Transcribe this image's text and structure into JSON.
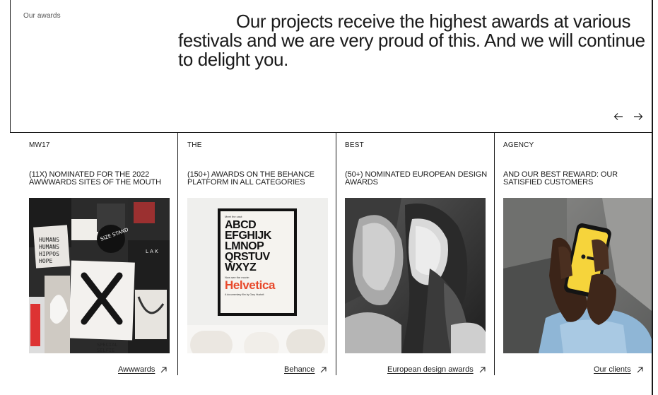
{
  "section": {
    "label": "Our awards"
  },
  "headline": {
    "text": "Our projects receive the highest awards at various festivals and we are very proud of this. And we will continue to delight you."
  },
  "carousel": {
    "prev_icon": "arrow-left-icon",
    "next_icon": "arrow-right-icon"
  },
  "cards": [
    {
      "tag": "MW17",
      "title": "(11X) NOMINATED FOR THE 2022 AWWWARDS SITES OF THE MOUTH",
      "image": "street-poster-wall",
      "link_label": "Awwwards",
      "link_icon": "arrow-up-right-icon"
    },
    {
      "tag": "THE",
      "title": "(150+) AWARDS ON THE BEHANCE PLATFORM IN ALL CATEGORIES",
      "image": "helvetica-poster",
      "link_label": "Behance",
      "link_icon": "arrow-up-right-icon",
      "poster": {
        "small_top": "Meet the cast:",
        "lines": [
          "ABCD",
          "EFGHIJK",
          "LMNOP",
          "QRSTUV",
          "WXYZ"
        ],
        "small_mid": "Now see the movie:",
        "brand": "Helvetica",
        "small_bottom": "A documentary film by Gary Hustwit"
      }
    },
    {
      "tag": "BEST",
      "title": "(50+) NOMINATED EUROPEAN DESIGN AWARDS",
      "image": "black-white-kiss-photo",
      "link_label": "European design awards",
      "link_icon": "arrow-up-right-icon"
    },
    {
      "tag": "AGENCY",
      "title": "AND OUR BEST REWARD: OUR SATISFIED CUSTOMERS",
      "image": "hand-holding-phone",
      "link_label": "Our clients",
      "link_icon": "arrow-up-right-icon",
      "phone_app": "bumble"
    }
  ],
  "colors": {
    "ink": "#1a1a1a",
    "helvetica_red": "#e8492b",
    "phone_yellow": "#f6d43b"
  }
}
